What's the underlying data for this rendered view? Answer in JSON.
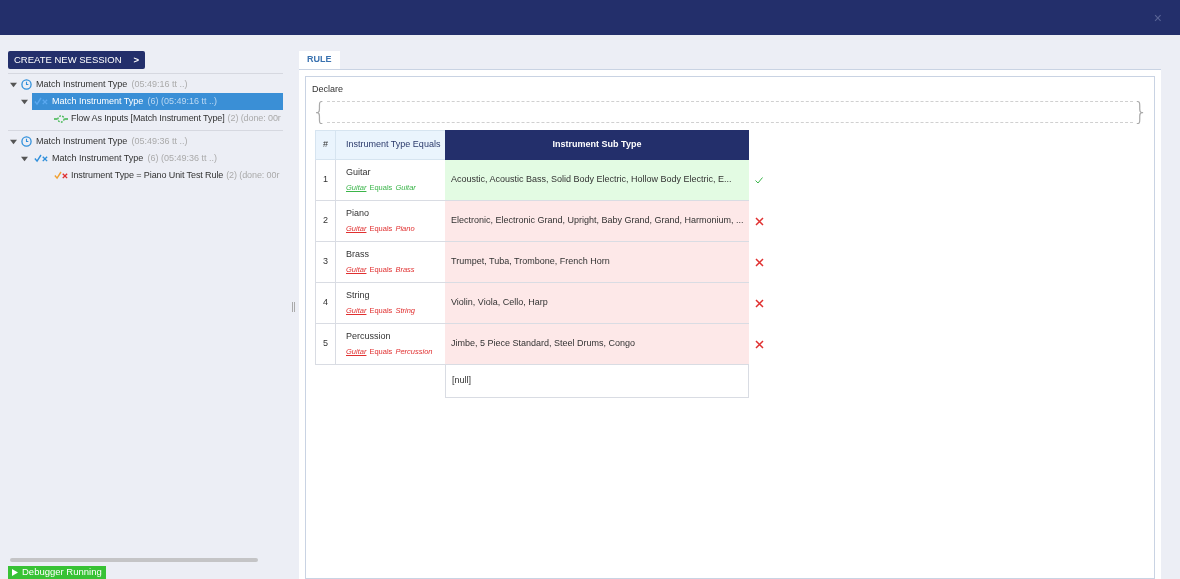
{
  "header": {
    "close": "×"
  },
  "sidebar": {
    "create_button": "CREATE NEW SESSION",
    "create_arrow": ">",
    "sessions": [
      {
        "label": "Match Instrument Type",
        "meta": "(05:49:16 tt ..)",
        "expanded": true,
        "children": [
          {
            "label": "Match Instrument Type",
            "meta": "(6) (05:49:16 tt ..)",
            "selected": true,
            "expanded": true,
            "children": [
              {
                "kind": "flow",
                "label": "Flow As Inputs [Match Instrument Type]",
                "meta": "(2) (done: 00r"
              }
            ]
          }
        ]
      },
      {
        "label": "Match Instrument Type",
        "meta": "(05:49:36 tt ..)",
        "expanded": true,
        "children": [
          {
            "label": "Match Instrument Type",
            "meta": "(6) (05:49:36 tt ..)",
            "selected": false,
            "expanded": true,
            "children": [
              {
                "kind": "rule",
                "label": "Instrument Type = Piano Unit Test Rule",
                "meta": "(2) (done: 00r"
              }
            ]
          }
        ]
      }
    ],
    "status_button": "Debugger Running"
  },
  "tabs": [
    {
      "label": "RULE",
      "selected": true
    }
  ],
  "declare": {
    "label": "Declare",
    "open_brace": "{",
    "close_brace": "}"
  },
  "table": {
    "columns": [
      "#",
      "Instrument Type Equals",
      "Instrument Sub Type"
    ],
    "rows": [
      {
        "number": "1",
        "type": "Guitar",
        "left": "Guitar",
        "op": "Equals",
        "right": "Guitar",
        "sub_type": "Acoustic, Acoustic Bass, Solid Body Electric, Hollow Body Electric, E...",
        "match": true
      },
      {
        "number": "2",
        "type": "Piano",
        "left": "Guitar",
        "op": "Equals",
        "right": "Piano",
        "sub_type": "Electronic, Electronic Grand, Upright, Baby Grand, Grand, Harmonium, ...",
        "match": false
      },
      {
        "number": "3",
        "type": "Brass",
        "left": "Guitar",
        "op": "Equals",
        "right": "Brass",
        "sub_type": "Trumpet, Tuba, Trombone, French Horn",
        "match": false
      },
      {
        "number": "4",
        "type": "String",
        "left": "Guitar",
        "op": "Equals",
        "right": "String",
        "sub_type": "Violin, Viola, Cello, Harp",
        "match": false
      },
      {
        "number": "5",
        "type": "Percussion",
        "left": "Guitar",
        "op": "Equals",
        "right": "Percussion",
        "sub_type": "Jimbe, 5 Piece Standard, Steel Drums, Congo",
        "match": false
      }
    ],
    "default_value": "[null]"
  }
}
